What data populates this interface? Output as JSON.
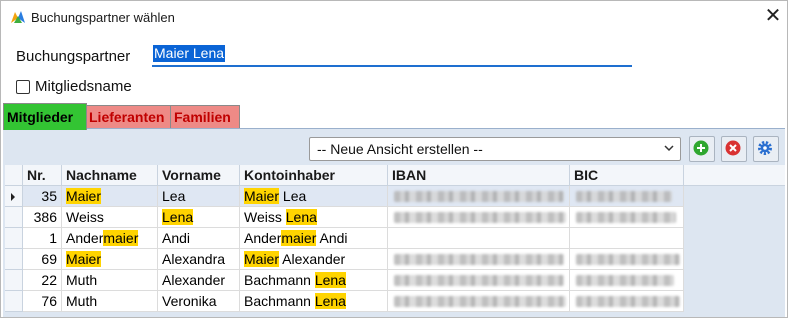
{
  "window": {
    "title": "Buchungspartner wählen"
  },
  "partner": {
    "label": "Buchungspartner",
    "value": "Maier Lena"
  },
  "member_name": {
    "label": "Mitgliedsname",
    "checked": false
  },
  "tabs": [
    {
      "label": "Mitglieder",
      "active": true
    },
    {
      "label": "Lieferanten",
      "active": false
    },
    {
      "label": "Familien",
      "active": false
    }
  ],
  "view": {
    "selected": "-- Neue Ansicht erstellen --"
  },
  "toolbar": {
    "add_icon": "add-icon",
    "delete_icon": "delete-icon",
    "settings_icon": "gear-icon"
  },
  "columns": [
    "Nr.",
    "Nachname",
    "Vorname",
    "Kontoinhaber",
    "IBAN",
    "BIC"
  ],
  "rows": [
    {
      "nr": "35",
      "nachname": [
        "",
        "Maier",
        ""
      ],
      "vorname": [
        "",
        "",
        "Lea"
      ],
      "konto": [
        "",
        "Maier",
        " Lea"
      ],
      "selected": true
    },
    {
      "nr": "386",
      "nachname": [
        "Weiss",
        "",
        ""
      ],
      "vorname": [
        "",
        "Lena",
        ""
      ],
      "konto": [
        "Weiss ",
        "Lena",
        ""
      ],
      "selected": false
    },
    {
      "nr": "1",
      "nachname": [
        "Ander",
        "maier",
        ""
      ],
      "vorname": [
        "Andi",
        "",
        ""
      ],
      "konto": [
        "Ander",
        "maier",
        " Andi"
      ],
      "selected": false
    },
    {
      "nr": "69",
      "nachname": [
        "",
        "Maier",
        ""
      ],
      "vorname": [
        "Alexandra",
        "",
        ""
      ],
      "konto": [
        "",
        "Maier",
        " Alexander"
      ],
      "selected": false
    },
    {
      "nr": "22",
      "nachname": [
        "Muth",
        "",
        ""
      ],
      "vorname": [
        "Alexander",
        "",
        ""
      ],
      "konto": [
        "Bachmann ",
        "Lena",
        ""
      ],
      "selected": false
    },
    {
      "nr": "76",
      "nachname": [
        "Muth",
        "",
        ""
      ],
      "vorname": [
        "Veronika",
        "",
        ""
      ],
      "konto": [
        "Bachmann ",
        "Lena",
        ""
      ],
      "selected": false
    }
  ],
  "colors": {
    "highlight": "#ffd400",
    "tab_active": "#33c433",
    "tab_inactive": "#ee8a86",
    "selection": "#0a64d6"
  }
}
